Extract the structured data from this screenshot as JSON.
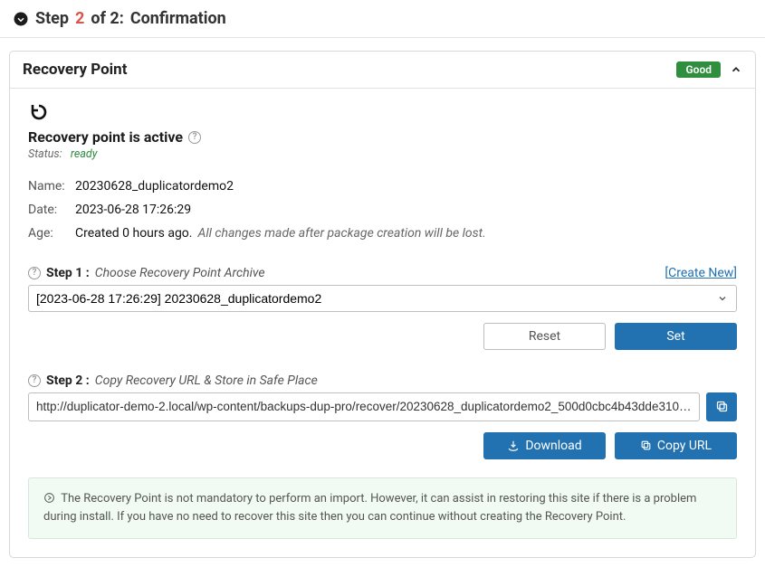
{
  "header": {
    "step_prefix": "Step",
    "step_number": "2",
    "step_total": "of 2:",
    "step_title": "Confirmation"
  },
  "panel": {
    "title": "Recovery Point",
    "badge": "Good"
  },
  "recovery": {
    "title": "Recovery point is active",
    "status_label": "Status:",
    "status_value": "ready",
    "name_label": "Name:",
    "name_value": "20230628_duplicatordemo2",
    "date_label": "Date:",
    "date_value": "2023-06-28 17:26:29",
    "age_label": "Age:",
    "age_value": "Created 0 hours ago.",
    "age_note": "All changes made after package creation will be lost."
  },
  "step1": {
    "label": "Step 1 :",
    "desc": "Choose Recovery Point Archive",
    "create_new": "Create New",
    "selected": "[2023-06-28 17:26:29] 20230628_duplicatordemo2",
    "reset": "Reset",
    "set": "Set"
  },
  "step2": {
    "label": "Step 2 :",
    "desc": "Copy Recovery URL & Store in Safe Place",
    "url": "http://duplicator-demo-2.local/wp-content/backups-dup-pro/recover/20230628_duplicatordemo2_500d0cbc4b43dde3102...",
    "download": "Download",
    "copy": "Copy URL"
  },
  "info": {
    "text": "The Recovery Point is not mandatory to perform an import. However, it can assist in restoring this site if there is a problem during install. If you have no need to recover this site then you can continue without creating the Recovery Point."
  }
}
